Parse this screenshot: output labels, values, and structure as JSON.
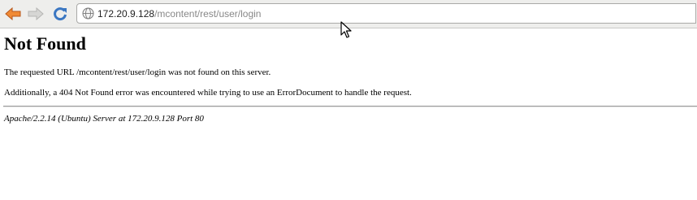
{
  "browser": {
    "url_host": "172.20.9.128",
    "url_path": "/mcontent/rest/user/login",
    "icons": {
      "back": "back-arrow-icon",
      "forward": "forward-arrow-icon",
      "reload": "reload-icon",
      "site": "globe-icon"
    },
    "colors": {
      "back_arrow": "#e07b2a",
      "reload": "#3b77c2",
      "toolbar_bg": "#eeeeec"
    }
  },
  "page": {
    "title": "Not Found",
    "message": "The requested URL /mcontent/rest/user/login was not found on this server.",
    "additional": "Additionally, a 404 Not Found error was encountered while trying to use an ErrorDocument to handle the request.",
    "server_signature": "Apache/2.2.14 (Ubuntu) Server at 172.20.9.128 Port 80"
  }
}
